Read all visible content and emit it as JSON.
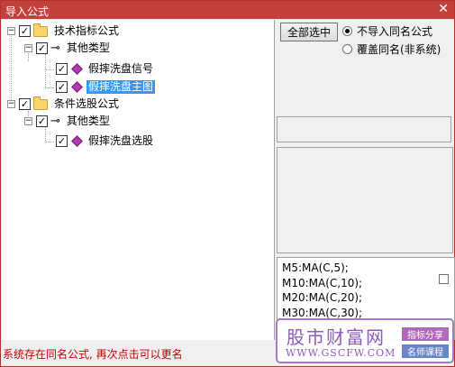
{
  "window": {
    "title": "导入公式",
    "close_glyph": "✕"
  },
  "tree": {
    "nodes": [
      {
        "label": "技术指标公式",
        "icon": "folder-icon",
        "checked": true,
        "expander": "−"
      },
      {
        "label": "其他类型",
        "icon": "key-icon",
        "checked": true,
        "expander": "−"
      },
      {
        "label": "假摔洗盘信号",
        "icon": "diamond-icon",
        "checked": true
      },
      {
        "label": "假摔洗盘主图",
        "icon": "diamond-icon",
        "checked": true,
        "selected": true
      },
      {
        "label": "条件选股公式",
        "icon": "folder-icon",
        "checked": true,
        "expander": "−"
      },
      {
        "label": "其他类型",
        "icon": "key-icon",
        "checked": true,
        "expander": "−"
      },
      {
        "label": "假摔洗盘选股",
        "icon": "diamond-icon",
        "checked": true
      }
    ]
  },
  "actions": {
    "select_all_label": "全部选中",
    "radio_no_import": "不导入同名公式",
    "radio_overwrite": "覆盖同名(非系统)",
    "selected_radio": "radio_no_import"
  },
  "formula_preview": {
    "lines": [
      "M5:MA(C,5);",
      "M10:MA(C,10);",
      "M20:MA(C,20);",
      "M30:MA(C,30);"
    ]
  },
  "status_message": "系统存在同名公式, 再次点击可以更名",
  "watermark": {
    "name": "股市财富网",
    "url": "WWW.GSCFW.COM",
    "tag1": "指标分享",
    "tag2": "名师课程"
  },
  "colors": {
    "titlebar": "#c4413b",
    "selection": "#3399ff",
    "status": "#c00000"
  }
}
